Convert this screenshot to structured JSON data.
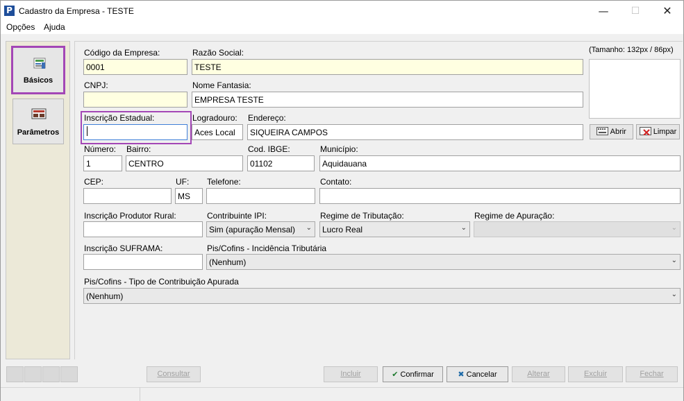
{
  "window": {
    "title": "Cadastro da Empresa - TESTE",
    "minimize": "—",
    "maximize": "☐",
    "close": "✕"
  },
  "menu": [
    "Opções",
    "Ajuda"
  ],
  "nav": {
    "basicos": "Básicos",
    "parametros": "Parâmetros"
  },
  "form": {
    "codigo_label": "Código da Empresa:",
    "codigo_value": "0001",
    "razao_label": "Razão Social:",
    "razao_value": "TESTE",
    "cnpj_label": "CNPJ:",
    "cnpj_value": "",
    "fantasia_label": "Nome Fantasia:",
    "fantasia_value": "EMPRESA TESTE",
    "ie_label": "Inscrição Estadual:",
    "ie_value": "",
    "logradouro_label": "Logradouro:",
    "logradouro_value": "Aces Local",
    "endereco_label": "Endereço:",
    "endereco_value": "SIQUEIRA CAMPOS",
    "numero_label": "Número:",
    "numero_value": "1",
    "bairro_label": "Bairro:",
    "bairro_value": "CENTRO",
    "ibge_label": "Cod. IBGE:",
    "ibge_value": "01102",
    "municipio_label": "Município:",
    "municipio_value": "Aquidauana",
    "cep_label": "CEP:",
    "cep_value": "",
    "uf_label": "UF:",
    "uf_value": "MS",
    "telefone_label": "Telefone:",
    "telefone_value": "",
    "contato_label": "Contato:",
    "contato_value": "",
    "produtor_label": "Inscrição Produtor Rural:",
    "produtor_value": "",
    "ipi_label": "Contribuinte IPI:",
    "ipi_value": "Sim (apuração Mensal)",
    "regime_trib_label": "Regime de Tributação:",
    "regime_trib_value": "Lucro Real",
    "regime_apur_label": "Regime de Apuração:",
    "regime_apur_value": "",
    "suframa_label": "Inscrição SUFRAMA:",
    "suframa_value": "",
    "pis_incid_label": "Pis/Cofins - Incidência Tributária",
    "pis_incid_value": "(Nenhum)",
    "pis_tipo_label": "Pis/Cofins - Tipo de Contribuição Apurada",
    "pis_tipo_value": "(Nenhum)"
  },
  "logo": {
    "size_label": "(Tamanho: 132px / 86px)",
    "abrir": "Abrir",
    "limpar": "Limpar"
  },
  "buttons": {
    "consultar": "Consultar",
    "incluir": "Incluir",
    "confirmar": "Confirmar",
    "cancelar": "Cancelar",
    "alterar": "Alterar",
    "excluir": "Excluir",
    "fechar": "Fechar"
  },
  "colors": {
    "highlight": "#a347b6",
    "yellow_field": "#ffffe1"
  }
}
